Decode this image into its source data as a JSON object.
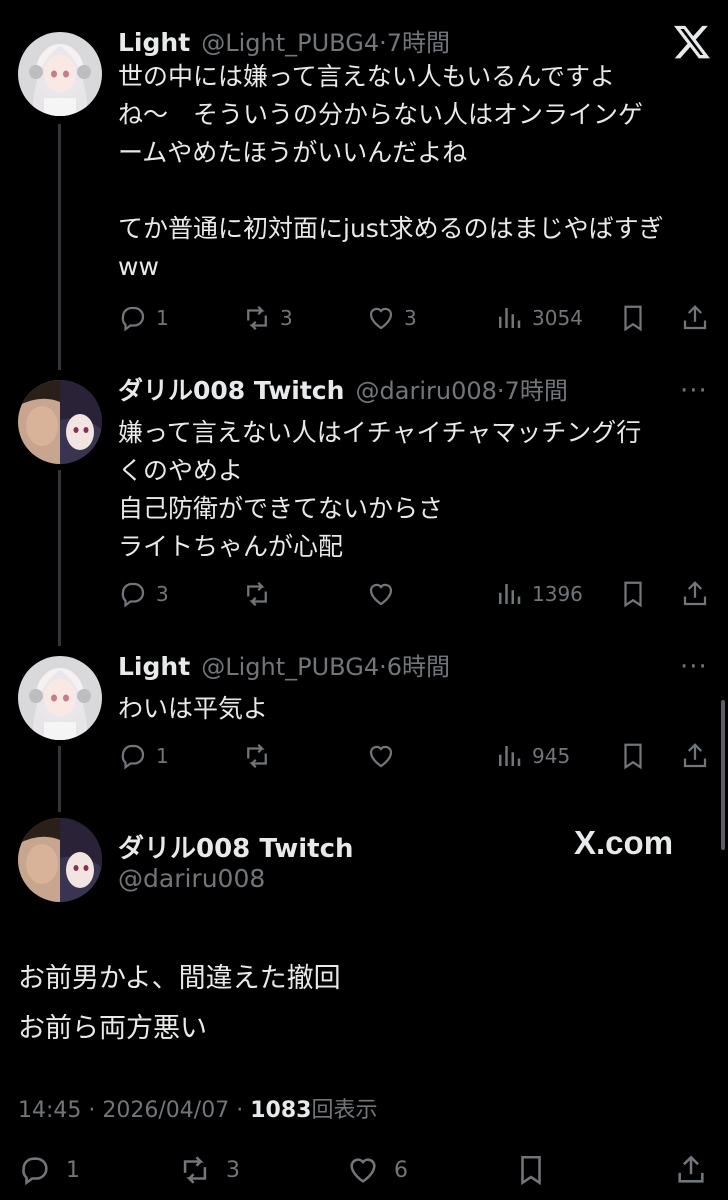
{
  "tweets": [
    {
      "name": "Light",
      "handle": "@Light_PUBG4",
      "time": "7時間",
      "text": "世の中には嫌って言えない人もいるんですよ\nね〜　そういうの分からない人はオンラインゲ\nームやめたほうがいいんだよね\n\nてか普通に初対面にjust求めるのはまじやばすぎ\nww",
      "replies": "1",
      "retweets": "3",
      "likes": "3",
      "views": "3054"
    },
    {
      "name": "ダリル008 Twitch",
      "handle": "@dariru008",
      "time": "7時間",
      "text": "嫌って言えない人はイチャイチャマッチング行\nくのやめよ\n自己防衛ができてないからさ\nライトちゃんが心配",
      "replies": "3",
      "retweets": "",
      "likes": "",
      "views": "1396"
    },
    {
      "name": "Light",
      "handle": "@Light_PUBG4",
      "time": "6時間",
      "text": "わいは平気よ",
      "replies": "1",
      "retweets": "",
      "likes": "",
      "views": "945"
    }
  ],
  "main": {
    "name": "ダリル008 Twitch",
    "handle": "@dariru008",
    "source": "X.com",
    "text": "お前男かよ、間違えた撤回\nお前ら両方悪い",
    "time": "14:45",
    "date": "2026/04/07",
    "views_count": "1083",
    "views_label": "回表示",
    "replies": "1",
    "retweets": "3",
    "likes": "6"
  },
  "separator": "·",
  "more_glyph": "···",
  "x_logo": "𝕏",
  "colors": {
    "bg": "#000000",
    "text": "#e7e9ea",
    "muted": "#71767b",
    "line": "#333639"
  }
}
